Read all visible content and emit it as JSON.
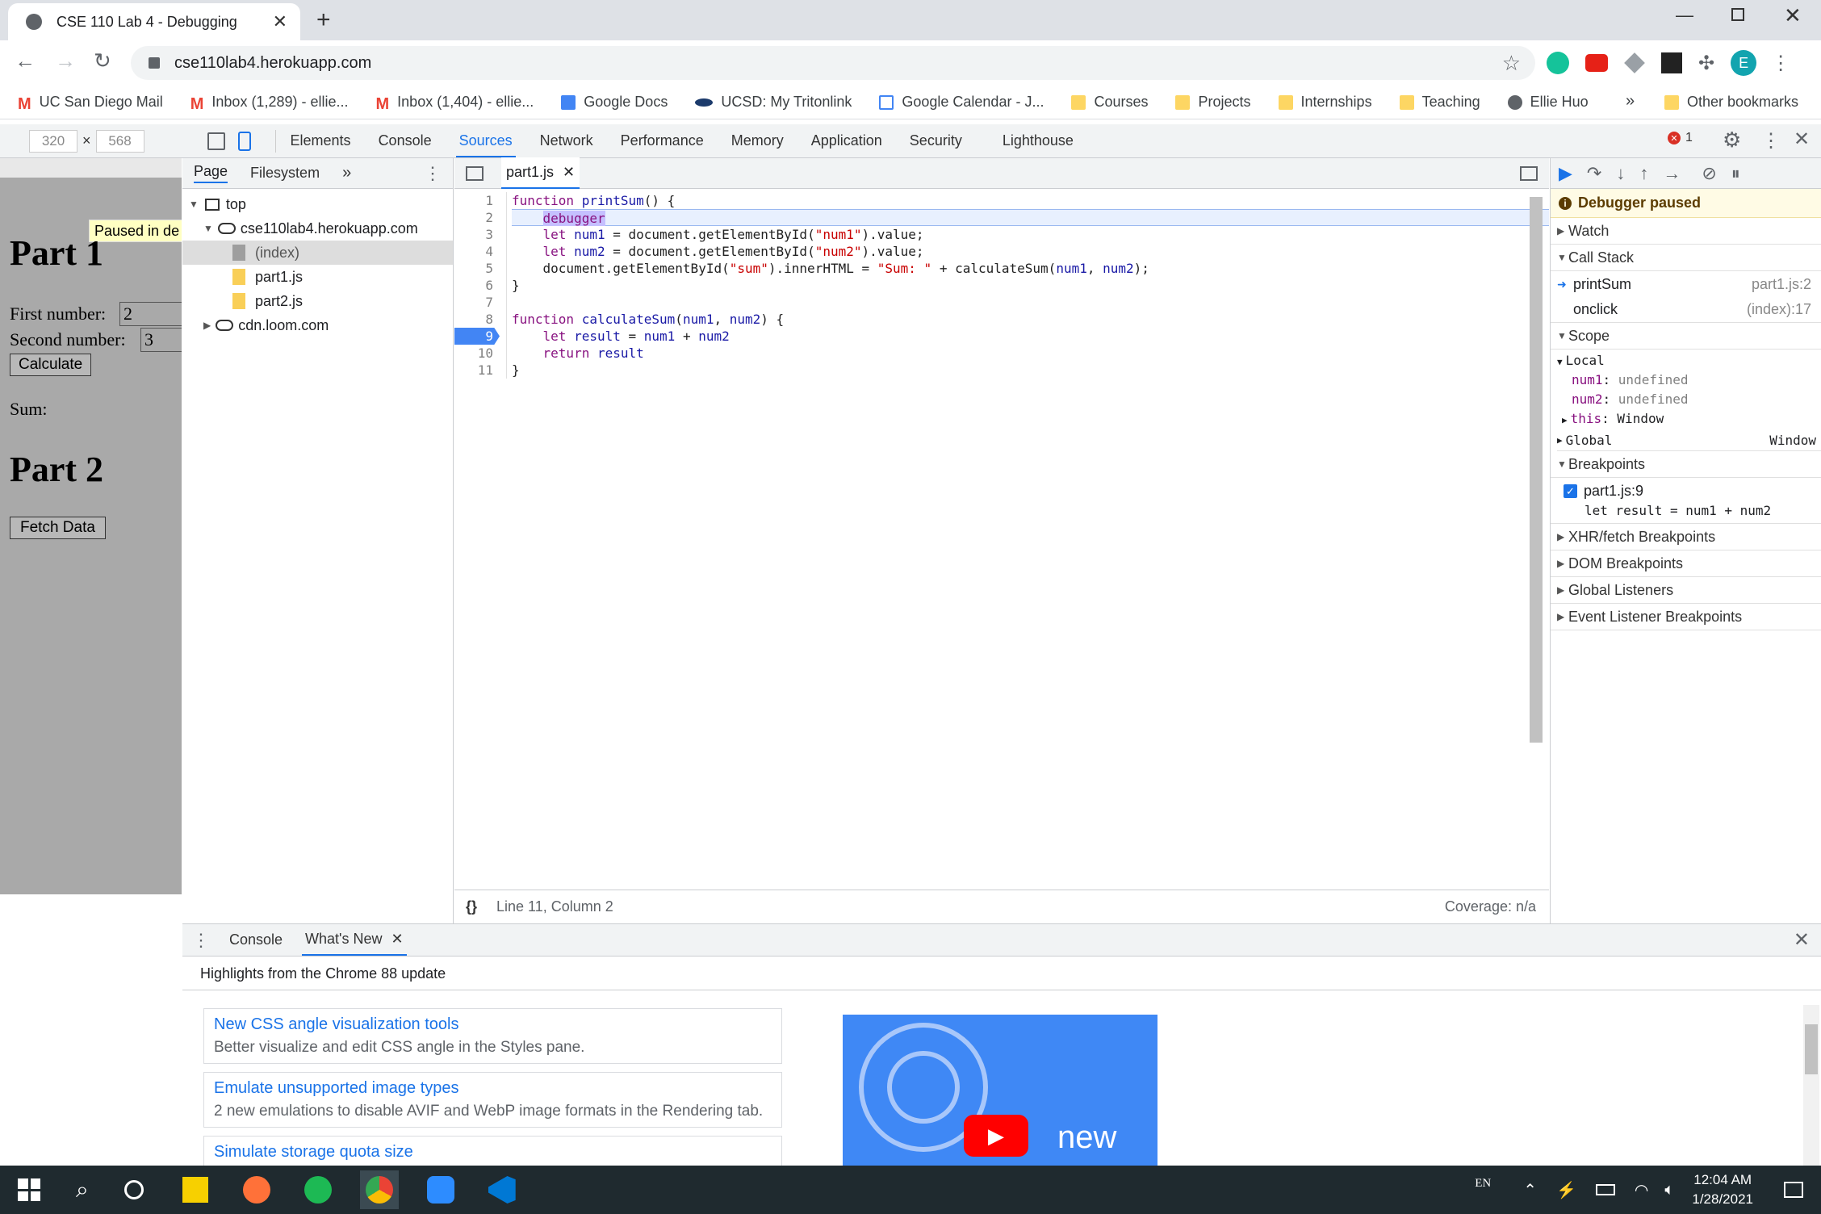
{
  "browser": {
    "tab_title": "CSE 110 Lab 4 - Debugging",
    "url": "cse110lab4.herokuapp.com",
    "profile_initial": "E",
    "bookmarks": [
      {
        "label": "UC San Diego Mail",
        "icon": "gmail-icon"
      },
      {
        "label": "Inbox (1,289) - ellie...",
        "icon": "gmail-icon"
      },
      {
        "label": "Inbox (1,404) - ellie...",
        "icon": "gmail-icon"
      },
      {
        "label": "Google Docs",
        "icon": "docs-icon"
      },
      {
        "label": "UCSD: My Tritonlink",
        "icon": "triton-icon"
      },
      {
        "label": "Google Calendar - J...",
        "icon": "calendar-icon"
      },
      {
        "label": "Courses",
        "icon": "folder-icon"
      },
      {
        "label": "Projects",
        "icon": "folder-icon"
      },
      {
        "label": "Internships",
        "icon": "folder-icon"
      },
      {
        "label": "Teaching",
        "icon": "folder-icon"
      },
      {
        "label": "Ellie Huo",
        "icon": "globe-icon"
      }
    ],
    "bookmarks_more": "»",
    "other_bookmarks": "Other bookmarks"
  },
  "device": {
    "width": "320",
    "height": "568",
    "sep": "×"
  },
  "devtools": {
    "tabs": [
      "Elements",
      "Console",
      "Sources",
      "Network",
      "Performance",
      "Memory",
      "Application",
      "Security",
      "Lighthouse"
    ],
    "active_tab": "Sources",
    "error_count": "1"
  },
  "webpage": {
    "paused_label": "Paused in de",
    "part1": "Part 1",
    "first_label": "First number:",
    "first_value": "2",
    "second_label": "Second number:",
    "second_value": "3",
    "calc_button": "Calculate",
    "sum_label": "Sum:",
    "part2": "Part 2",
    "fetch_button": "Fetch Data"
  },
  "navigator": {
    "tabs": [
      "Page",
      "Filesystem"
    ],
    "more": "»",
    "tree": {
      "top": "top",
      "domain": "cse110lab4.herokuapp.com",
      "files": [
        "(index)",
        "part1.js",
        "part2.js"
      ],
      "cdn": "cdn.loom.com"
    }
  },
  "editor": {
    "file_tab": "part1.js",
    "lines": [
      "1",
      "2",
      "3",
      "4",
      "5",
      "6",
      "7",
      "8",
      "9",
      "10",
      "11"
    ],
    "status_position": "Line 11, Column 2",
    "coverage": "Coverage: n/a",
    "pretty_print": "{}"
  },
  "debugger": {
    "paused_banner": "Debugger paused",
    "watch": "Watch",
    "call_stack": "Call Stack",
    "frames": [
      {
        "name": "printSum",
        "loc": "part1.js:2"
      },
      {
        "name": "onclick",
        "loc": "(index):17"
      }
    ],
    "scope": "Scope",
    "local": "Local",
    "vars": [
      {
        "name": "num1",
        "value": "undefined"
      },
      {
        "name": "num2",
        "value": "undefined"
      },
      {
        "name": "this",
        "value": "Window"
      }
    ],
    "global": "Global",
    "global_value": "Window",
    "breakpoints": "Breakpoints",
    "bp_file": "part1.js:9",
    "bp_code": "let result = num1 + num2",
    "sections": [
      "XHR/fetch Breakpoints",
      "DOM Breakpoints",
      "Global Listeners",
      "Event Listener Breakpoints"
    ]
  },
  "drawer": {
    "tabs": [
      "Console",
      "What's New"
    ],
    "highlight": "Highlights from the Chrome 88 update",
    "cards": [
      {
        "title": "New CSS angle visualization tools",
        "desc": "Better visualize and edit CSS angle in the Styles pane."
      },
      {
        "title": "Emulate unsupported image types",
        "desc": "2 new emulations to disable AVIF and WebP image formats in the Rendering tab."
      },
      {
        "title": "Simulate storage quota size",
        "desc": ""
      }
    ],
    "video_text": "new"
  },
  "taskbar": {
    "lang": "EN",
    "time": "12:04 AM",
    "date": "1/28/2021"
  }
}
